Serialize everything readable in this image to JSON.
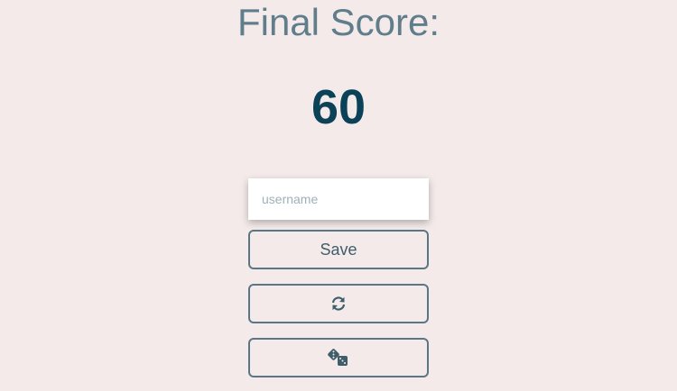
{
  "heading": "Final Score:",
  "score": "60",
  "form": {
    "username_placeholder": "username",
    "username_value": "",
    "save_label": "Save"
  },
  "actions": {
    "restart_icon": "refresh-icon",
    "random_icon": "dice-icon"
  },
  "colors": {
    "background": "#f4eaea",
    "heading": "#607d8b",
    "score": "#0b4258",
    "button_border": "#5b7684"
  }
}
